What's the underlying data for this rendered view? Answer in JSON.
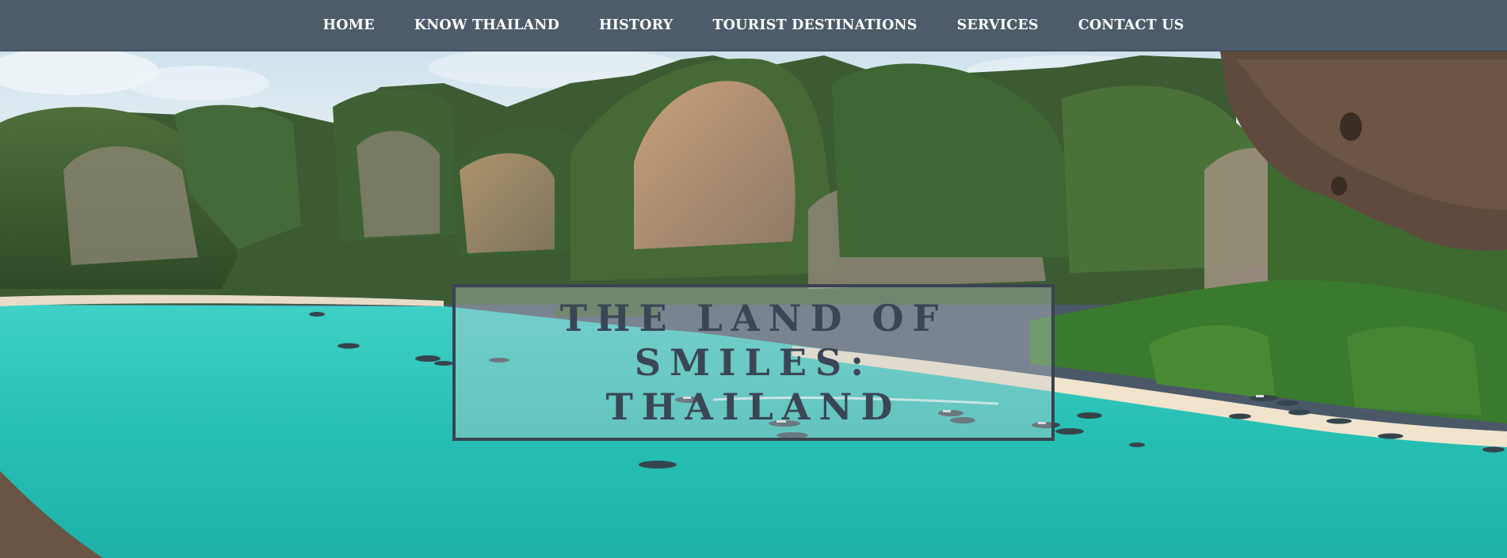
{
  "nav": {
    "items": [
      {
        "label": "HOME"
      },
      {
        "label": "KNOW THAILAND"
      },
      {
        "label": "HISTORY"
      },
      {
        "label": "TOURIST DESTINATIONS"
      },
      {
        "label": "SERVICES"
      },
      {
        "label": "CONTACT US"
      }
    ]
  },
  "hero": {
    "title_line1": "THE LAND OF SMILES:",
    "title_line2": "THAILAND",
    "image": "tropical bay with limestone cliffs, turquoise water and longtail boats"
  },
  "colors": {
    "nav_bg": "#4d5b6b",
    "nav_text": "#ffffff",
    "title_text": "#3a4656",
    "title_border": "#3a4350",
    "water": "#2ec4b6",
    "sky": "#d8e6ee"
  }
}
